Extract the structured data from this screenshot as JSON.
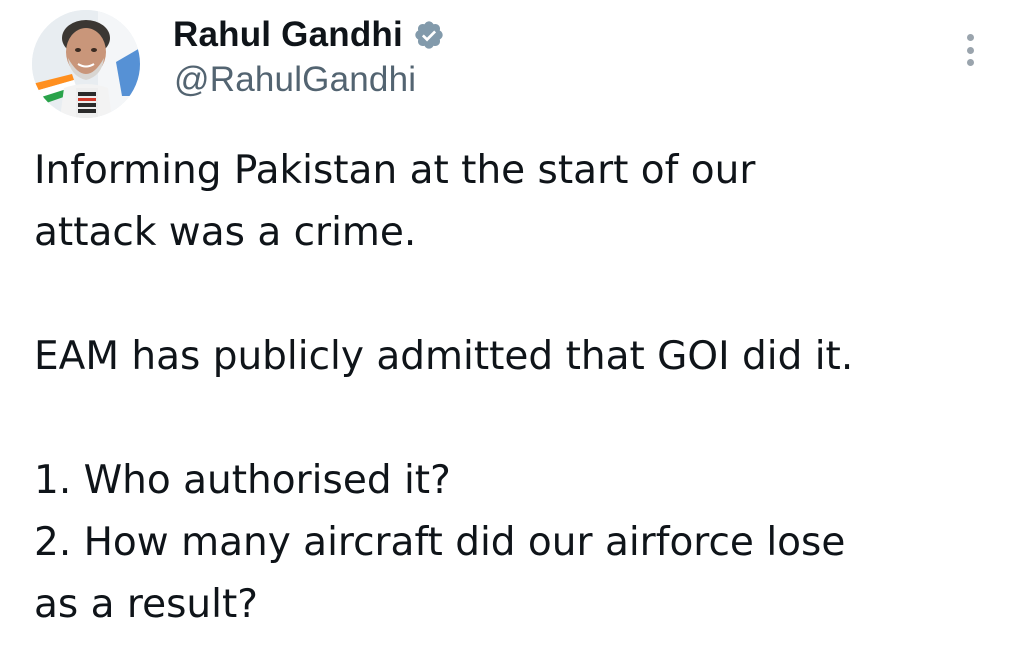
{
  "author": {
    "display_name": "Rahul Gandhi",
    "handle": "@RahulGandhi",
    "verified": true,
    "avatar": "profile-photo"
  },
  "tweet": {
    "paragraphs": [
      "Informing Pakistan at the start of our\nattack was a crime.",
      "EAM has publicly admitted that GOI did it.",
      "1. Who authorised it?\n2. How many aircraft did our airforce lose\nas a result?"
    ]
  },
  "icons": {
    "verified": "verified-badge-icon",
    "more": "more-options-icon"
  },
  "colors": {
    "text": "#0f1419",
    "secondary_text": "#536471",
    "badge": "#829aab",
    "menu_dots": "#9aa4ad"
  }
}
